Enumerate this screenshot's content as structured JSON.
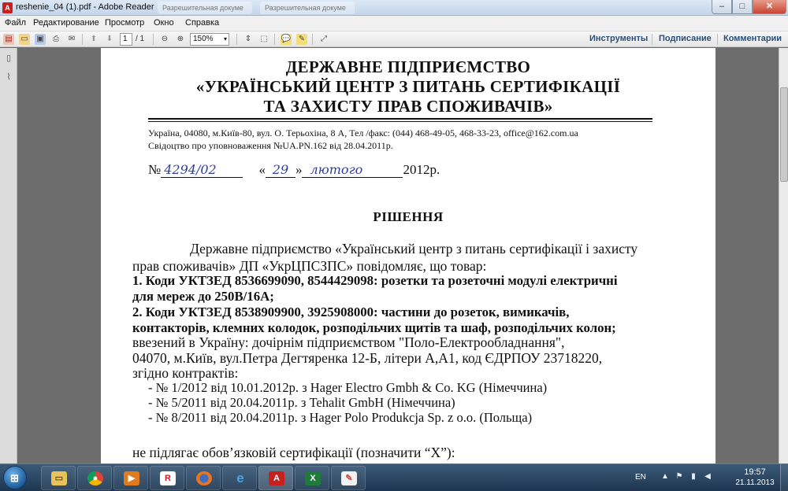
{
  "window": {
    "title": "reshenie_04 (1).pdf - Adobe Reader",
    "ghost_tabs": [
      "Разрешительная докуме",
      "Разрешительная докуме"
    ],
    "min": "–",
    "max": "□",
    "close": "✕"
  },
  "menu": [
    "Файл",
    "Редактирование",
    "Просмотр",
    "Окно",
    "Справка"
  ],
  "toolbar": {
    "page_current": "1",
    "page_total": "/ 1",
    "zoom": "150%",
    "tools": "Инструменты",
    "sign": "Подписание",
    "comments": "Комментарии"
  },
  "document": {
    "header": [
      "ДЕРЖАВНЕ ПІДПРИЄМСТВО",
      "«УКРАЇНСЬКИЙ ЦЕНТР З ПИТАНЬ СЕРТИФІКАЦІЇ",
      "ТА ЗАХИСТУ ПРАВ СПОЖИВАЧІВ»"
    ],
    "address": "Україна, 04080, м.Київ-80, вул. О. Терьохіна, 8 А, Тел /факс:  (044) 468-49-05, 468-33-23, office@162.com.ua",
    "certificate": "Свідоцтво про уповноваження №UA.PN.162 від 28.04.2011р.",
    "number_prefix": "№",
    "number_handwritten": "4294/02",
    "date_open": "«",
    "day_handwritten": "29",
    "date_close": "»",
    "month_handwritten": "лютого",
    "year": "2012р.",
    "decision_title": "РІШЕННЯ",
    "paragraph_1": "Державне підприємство «Український центр з питань сертифікації і захисту",
    "paragraph_2": "прав  споживачів» ДП «УкрЦПСЗПС» повідомляє, що товар:",
    "item_1a": "1. Коди УКТЗЕД 8536699090, 8544429098: розетки та розеточні модулі електричні",
    "item_1b": "для мереж до 250В/16А;",
    "item_2a": "2. Коди УКТЗЕД 8538909900, 3925908000: частини до розеток, вимикачів,",
    "item_2b": "контакторів, клемних колодок, розподільчих щитів та шаф, розподільчих колон;",
    "imported_1": "ввезений  в Україну: дочірнім підприємством  \"Поло-Електрообладнання\",",
    "imported_2": "04070,  м.Київ,  вул.Петра Дегтяренка 12-Б, літери А,А1, код ЄДРПОУ 23718220,",
    "imported_3": "згідно контрактів:",
    "contracts": [
      "-    № 1/2012 від 10.01.2012р. з Hager Electro Gmbh & Co. KG (Німеччина)",
      "-    № 5/2011 від 20.04.2011р. з Tehalit GmbH (Німеччина)",
      "-    № 8/2011 від 20.04.2011р. з Hager Polo Produkcja Sp. z o.o. (Польща)"
    ],
    "conclusion": "не  підлягає обов’язковій сертифікації (позначити “Х”):"
  },
  "taskbar": {
    "lang": "EN",
    "time": "19:57",
    "date": "21.11.2013",
    "apps": [
      "file-explorer",
      "chrome",
      "media-player",
      "r-app",
      "firefox",
      "internet-explorer",
      "adobe-reader",
      "excel",
      "paint"
    ]
  },
  "colors": {
    "handwriting": "#2f3f9a",
    "taskbar": "#1d3550",
    "accent_link": "#2a4f7a"
  }
}
